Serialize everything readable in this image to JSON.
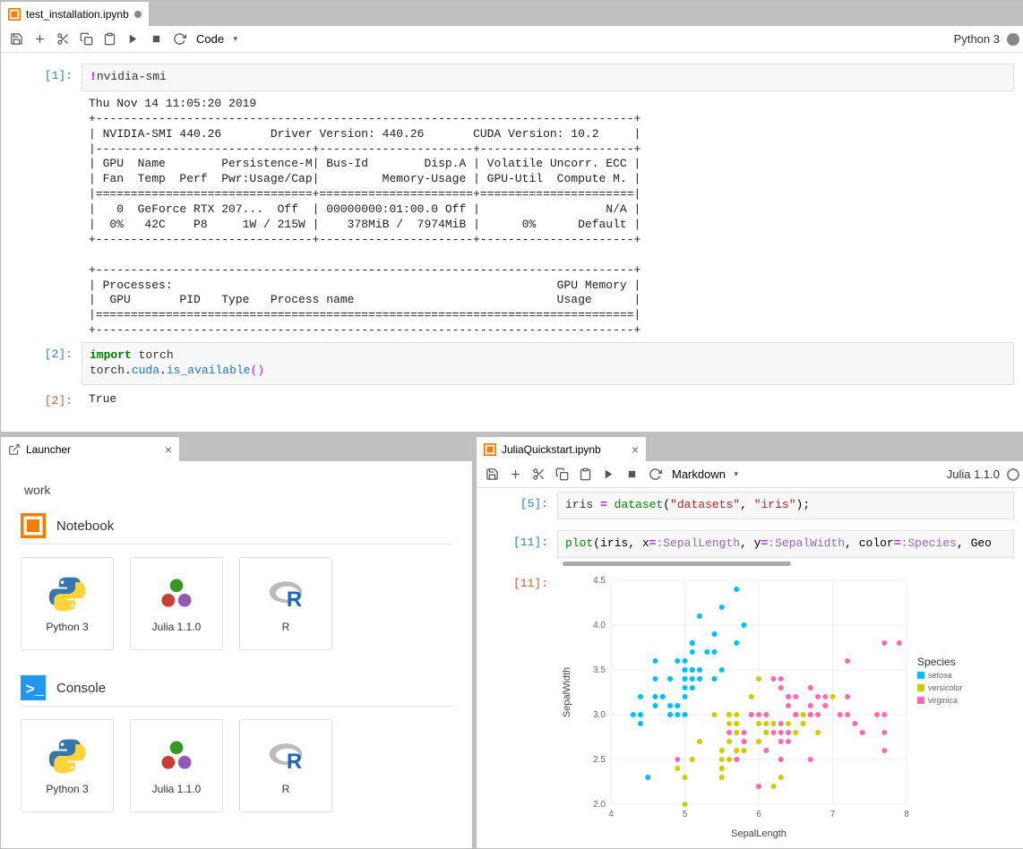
{
  "top": {
    "tab_title": "test_installation.ipynb",
    "cell_type": "Code",
    "kernel": "Python 3",
    "cell1_prompt": "[1]:",
    "cell1_code_html": "<span class='c-magic'>!</span><span class='c-text'>nvidia</span><span class='c-op'>-</span><span class='c-text'>smi</span>",
    "cell1_output": "Thu Nov 14 11:05:20 2019\n+-----------------------------------------------------------------------------+\n| NVIDIA-SMI 440.26       Driver Version: 440.26       CUDA Version: 10.2     |\n|-------------------------------+----------------------+----------------------+\n| GPU  Name        Persistence-M| Bus-Id        Disp.A | Volatile Uncorr. ECC |\n| Fan  Temp  Perf  Pwr:Usage/Cap|         Memory-Usage | GPU-Util  Compute M. |\n|===============================+======================+======================|\n|   0  GeForce RTX 207...  Off  | 00000000:01:00.0 Off |                  N/A |\n|  0%   42C    P8     1W / 215W |    378MiB /  7974MiB |      0%      Default |\n+-------------------------------+----------------------+----------------------+\n\n+-----------------------------------------------------------------------------+\n| Processes:                                                       GPU Memory |\n|  GPU       PID   Type   Process name                             Usage      |\n|=============================================================================|\n+-----------------------------------------------------------------------------+",
    "cell2_prompt": "[2]:",
    "cell2_code_html": "<span class='c-kw'>import</span> <span class='c-name'>torch</span>\n<span class='c-name'>torch</span>.<span class='c-attr'>cuda</span>.<span class='c-func'>is_available</span><span class='c-paren'>()</span>",
    "cell2_out_prompt": "[2]:",
    "cell2_output": "True"
  },
  "launcher": {
    "tab_title": "Launcher",
    "folder": "work",
    "sections": [
      {
        "title": "Notebook",
        "cards": [
          {
            "label": "Python 3",
            "icon": "python"
          },
          {
            "label": "Julia 1.1.0",
            "icon": "julia"
          },
          {
            "label": "R",
            "icon": "r"
          }
        ]
      },
      {
        "title": "Console",
        "cards": [
          {
            "label": "Python 3",
            "icon": "python"
          },
          {
            "label": "Julia 1.1.0",
            "icon": "julia"
          },
          {
            "label": "R",
            "icon": "r"
          }
        ]
      }
    ]
  },
  "julia": {
    "tab_title": "JuliaQuickstart.ipynb",
    "cell_type": "Markdown",
    "kernel": "Julia 1.1.0",
    "cell5_prompt": "[5]:",
    "cell5_code_html": "<span class='c-name'>iris</span> <span class='c-op'>=</span> <span class='c-callf'>dataset</span>(<span class='c-str'>\"datasets\"</span>, <span class='c-str'>\"iris\"</span>);",
    "cell11_prompt": "[11]:",
    "cell11_code_html": "<span class='c-callf'>plot</span>(iris, x<span class='c-op'>=</span><span class='c-sym'>:SepalLength</span>, y<span class='c-op'>=</span><span class='c-sym'>:SepalWidth</span>, color<span class='c-op'>=</span><span class='c-sym'>:Species</span>, Geo",
    "cell11_out_prompt": "[11]:"
  },
  "chart_data": {
    "type": "scatter",
    "title": "",
    "xlabel": "SepalLength",
    "ylabel": "SepalWidth",
    "xlim": [
      4,
      8
    ],
    "ylim": [
      2.0,
      4.5
    ],
    "xticks": [
      4,
      5,
      6,
      7,
      8
    ],
    "yticks": [
      2.0,
      2.5,
      3.0,
      3.5,
      4.0,
      4.5
    ],
    "legend_title": "Species",
    "colors": {
      "setosa": "#00bfff",
      "versicolor": "#cccc00",
      "virginica": "#ff69b4"
    },
    "series": [
      {
        "name": "setosa",
        "points": [
          [
            5.1,
            3.5
          ],
          [
            4.9,
            3.0
          ],
          [
            4.7,
            3.2
          ],
          [
            4.6,
            3.1
          ],
          [
            5.0,
            3.6
          ],
          [
            5.4,
            3.9
          ],
          [
            4.6,
            3.4
          ],
          [
            5.0,
            3.4
          ],
          [
            4.4,
            2.9
          ],
          [
            4.9,
            3.1
          ],
          [
            5.4,
            3.7
          ],
          [
            4.8,
            3.4
          ],
          [
            4.8,
            3.0
          ],
          [
            4.3,
            3.0
          ],
          [
            5.8,
            4.0
          ],
          [
            5.7,
            4.4
          ],
          [
            5.4,
            3.9
          ],
          [
            5.1,
            3.5
          ],
          [
            5.7,
            3.8
          ],
          [
            5.1,
            3.8
          ],
          [
            5.4,
            3.4
          ],
          [
            5.1,
            3.7
          ],
          [
            4.6,
            3.6
          ],
          [
            5.1,
            3.3
          ],
          [
            4.8,
            3.4
          ],
          [
            5.0,
            3.0
          ],
          [
            5.0,
            3.4
          ],
          [
            5.2,
            3.5
          ],
          [
            5.2,
            3.4
          ],
          [
            4.7,
            3.2
          ],
          [
            4.8,
            3.1
          ],
          [
            5.4,
            3.4
          ],
          [
            5.2,
            4.1
          ],
          [
            5.5,
            4.2
          ],
          [
            4.9,
            3.1
          ],
          [
            5.0,
            3.2
          ],
          [
            5.5,
            3.5
          ],
          [
            4.9,
            3.6
          ],
          [
            4.4,
            3.0
          ],
          [
            5.1,
            3.4
          ],
          [
            5.0,
            3.5
          ],
          [
            4.5,
            2.3
          ],
          [
            4.4,
            3.2
          ],
          [
            5.0,
            3.5
          ],
          [
            5.1,
            3.8
          ],
          [
            4.8,
            3.0
          ],
          [
            5.1,
            3.8
          ],
          [
            4.6,
            3.2
          ],
          [
            5.3,
            3.7
          ],
          [
            5.0,
            3.3
          ]
        ]
      },
      {
        "name": "versicolor",
        "points": [
          [
            7.0,
            3.2
          ],
          [
            6.4,
            3.2
          ],
          [
            6.9,
            3.1
          ],
          [
            5.5,
            2.3
          ],
          [
            6.5,
            2.8
          ],
          [
            5.7,
            2.8
          ],
          [
            6.3,
            3.3
          ],
          [
            4.9,
            2.4
          ],
          [
            6.6,
            2.9
          ],
          [
            5.2,
            2.7
          ],
          [
            5.0,
            2.0
          ],
          [
            5.9,
            3.0
          ],
          [
            6.0,
            2.2
          ],
          [
            6.1,
            2.9
          ],
          [
            5.6,
            2.9
          ],
          [
            6.7,
            3.1
          ],
          [
            5.6,
            3.0
          ],
          [
            5.8,
            2.7
          ],
          [
            6.2,
            2.2
          ],
          [
            5.6,
            2.5
          ],
          [
            5.9,
            3.2
          ],
          [
            6.1,
            2.8
          ],
          [
            6.3,
            2.5
          ],
          [
            6.1,
            2.8
          ],
          [
            6.4,
            2.9
          ],
          [
            6.6,
            3.0
          ],
          [
            6.8,
            2.8
          ],
          [
            6.7,
            3.0
          ],
          [
            6.0,
            2.9
          ],
          [
            5.7,
            2.6
          ],
          [
            5.5,
            2.4
          ],
          [
            5.5,
            2.4
          ],
          [
            5.8,
            2.7
          ],
          [
            6.0,
            2.7
          ],
          [
            5.4,
            3.0
          ],
          [
            6.0,
            3.4
          ],
          [
            6.7,
            3.1
          ],
          [
            6.3,
            2.3
          ],
          [
            5.6,
            3.0
          ],
          [
            5.5,
            2.5
          ],
          [
            5.5,
            2.6
          ],
          [
            6.1,
            3.0
          ],
          [
            5.8,
            2.6
          ],
          [
            5.0,
            2.3
          ],
          [
            5.6,
            2.7
          ],
          [
            5.7,
            3.0
          ],
          [
            5.7,
            2.9
          ],
          [
            6.2,
            2.9
          ],
          [
            5.1,
            2.5
          ],
          [
            5.7,
            2.8
          ]
        ]
      },
      {
        "name": "virginica",
        "points": [
          [
            6.3,
            3.3
          ],
          [
            5.8,
            2.7
          ],
          [
            7.1,
            3.0
          ],
          [
            6.3,
            2.9
          ],
          [
            6.5,
            3.0
          ],
          [
            7.6,
            3.0
          ],
          [
            4.9,
            2.5
          ],
          [
            7.3,
            2.9
          ],
          [
            6.7,
            2.5
          ],
          [
            7.2,
            3.6
          ],
          [
            6.5,
            3.2
          ],
          [
            6.4,
            2.7
          ],
          [
            6.8,
            3.0
          ],
          [
            5.7,
            2.5
          ],
          [
            5.8,
            2.8
          ],
          [
            6.4,
            3.2
          ],
          [
            6.5,
            3.0
          ],
          [
            7.7,
            3.8
          ],
          [
            7.7,
            2.6
          ],
          [
            6.0,
            2.2
          ],
          [
            6.9,
            3.2
          ],
          [
            5.6,
            2.8
          ],
          [
            7.7,
            2.8
          ],
          [
            6.3,
            2.7
          ],
          [
            6.7,
            3.3
          ],
          [
            7.2,
            3.2
          ],
          [
            6.2,
            2.8
          ],
          [
            6.1,
            3.0
          ],
          [
            6.4,
            2.8
          ],
          [
            7.2,
            3.0
          ],
          [
            7.4,
            2.8
          ],
          [
            7.9,
            3.8
          ],
          [
            6.4,
            2.8
          ],
          [
            6.3,
            2.8
          ],
          [
            6.1,
            2.6
          ],
          [
            7.7,
            3.0
          ],
          [
            6.3,
            3.4
          ],
          [
            6.4,
            3.1
          ],
          [
            6.0,
            3.0
          ],
          [
            6.9,
            3.1
          ],
          [
            6.7,
            3.1
          ],
          [
            6.9,
            3.1
          ],
          [
            5.8,
            2.7
          ],
          [
            6.8,
            3.2
          ],
          [
            6.7,
            3.3
          ],
          [
            6.7,
            3.0
          ],
          [
            6.3,
            2.5
          ],
          [
            6.5,
            3.0
          ],
          [
            6.2,
            3.4
          ],
          [
            5.9,
            3.0
          ]
        ]
      }
    ]
  }
}
